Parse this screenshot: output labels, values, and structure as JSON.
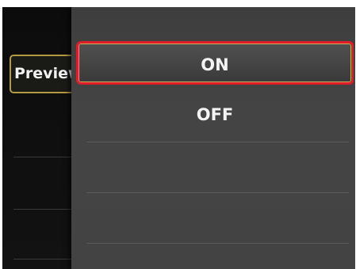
{
  "background": {
    "item_label": "Preview"
  },
  "popup": {
    "options": [
      {
        "label": "ON",
        "selected": true
      },
      {
        "label": "OFF",
        "selected": false
      }
    ]
  },
  "colors": {
    "selection_border": "#e01c2a",
    "bg_item_border": "#b39a43",
    "popup_bg": "#434343",
    "screen_bg": "#090909"
  }
}
